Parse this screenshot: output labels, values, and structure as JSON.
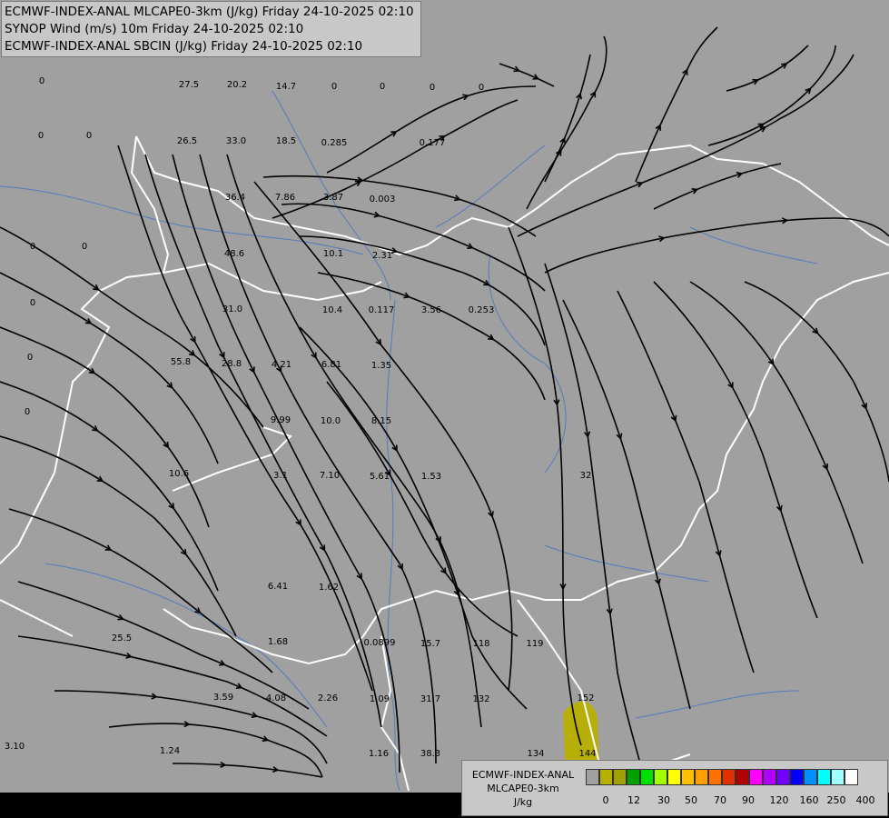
{
  "header": {
    "line1": "ECMWF-INDEX-ANAL MLCAPE0-3km (J/kg) Friday 24-10-2025 02:10",
    "line2": "SYNOP Wind (m/s) 10m Friday 24-10-2025 02:10",
    "line3": "ECMWF-INDEX-ANAL SBCIN (J/kg) Friday 24-10-2025 02:10"
  },
  "legend": {
    "title1": "ECMWF-INDEX-ANAL",
    "title2": "MLCAPE0-3km",
    "title3": "J/kg",
    "colors": [
      "#a0a0a0",
      "#b8b000",
      "#a0a000",
      "#00a000",
      "#00e000",
      "#a0ff00",
      "#ffff00",
      "#ffc000",
      "#ffa000",
      "#ff7000",
      "#e03000",
      "#b00000",
      "#ff00ff",
      "#b000ff",
      "#7000ff",
      "#0000ff",
      "#0090ff",
      "#00ffff",
      "#a0ffff",
      "#ffffff"
    ],
    "ticks": [
      "0",
      "12",
      "30",
      "50",
      "70",
      "90",
      "120",
      "160",
      "250",
      "400"
    ]
  },
  "values": [
    {
      "t": "0"
    },
    {
      "t": "0"
    },
    {
      "t": "0"
    },
    {
      "t": "0"
    },
    {
      "t": "0"
    },
    {
      "t": "0"
    },
    {
      "t": "0"
    },
    {
      "t": "0"
    },
    {
      "t": "27.5"
    },
    {
      "t": "20.2"
    },
    {
      "t": "14.7"
    },
    {
      "t": "0"
    },
    {
      "t": "0"
    },
    {
      "t": "0"
    },
    {
      "t": "0"
    },
    {
      "t": "26.5"
    },
    {
      "t": "33.0"
    },
    {
      "t": "18.5"
    },
    {
      "t": "0.285"
    },
    {
      "t": "0.177"
    },
    {
      "t": "36.4"
    },
    {
      "t": "7.86"
    },
    {
      "t": "3.87"
    },
    {
      "t": "0.003"
    },
    {
      "t": "48.6"
    },
    {
      "t": "10.1"
    },
    {
      "t": "2.31"
    },
    {
      "t": "31.0"
    },
    {
      "t": "10.4"
    },
    {
      "t": "0.117"
    },
    {
      "t": "3.56"
    },
    {
      "t": "0.253"
    },
    {
      "t": "55.8"
    },
    {
      "t": "28.8"
    },
    {
      "t": "4.21"
    },
    {
      "t": "6.81"
    },
    {
      "t": "1.35"
    },
    {
      "t": "9.99"
    },
    {
      "t": "10.0"
    },
    {
      "t": "8.15"
    },
    {
      "t": "10.6"
    },
    {
      "t": "3.1"
    },
    {
      "t": "7.10"
    },
    {
      "t": "5.61"
    },
    {
      "t": "1.53"
    },
    {
      "t": "32"
    },
    {
      "t": "6.41"
    },
    {
      "t": "1.62"
    },
    {
      "t": "25.5"
    },
    {
      "t": "1.68"
    },
    {
      "t": "0.0899"
    },
    {
      "t": "15.7"
    },
    {
      "t": "118"
    },
    {
      "t": "119"
    },
    {
      "t": "3.59"
    },
    {
      "t": "4.08"
    },
    {
      "t": "2.26"
    },
    {
      "t": "1.09"
    },
    {
      "t": "31.7"
    },
    {
      "t": "132"
    },
    {
      "t": "152"
    },
    {
      "t": "3.10"
    },
    {
      "t": "1.24"
    },
    {
      "t": "1.16"
    },
    {
      "t": "38.3"
    },
    {
      "t": "134"
    },
    {
      "t": "144"
    }
  ]
}
